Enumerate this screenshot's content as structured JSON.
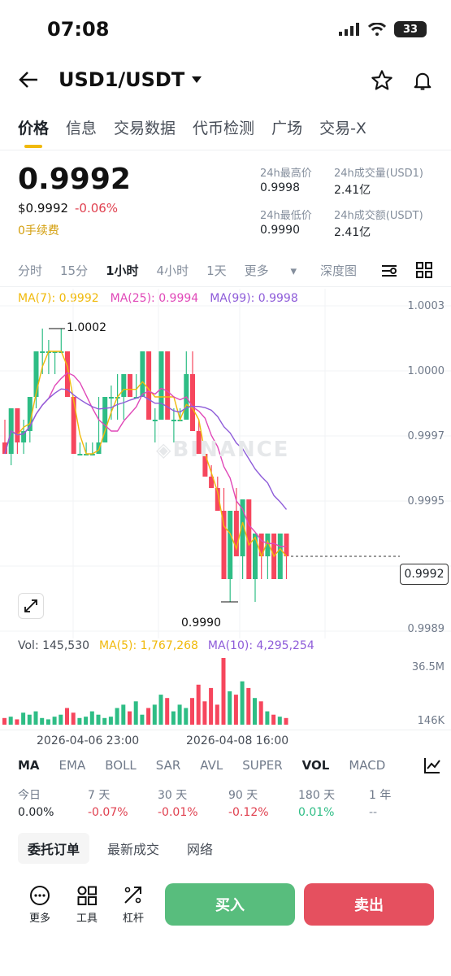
{
  "status_bar": {
    "time": "07:08",
    "battery": "33"
  },
  "header": {
    "pair": "USD1/USDT"
  },
  "tabs": [
    "价格",
    "信息",
    "交易数据",
    "代币检测",
    "广场",
    "交易-X"
  ],
  "ticker": {
    "price": "0.9992",
    "usd_price": "$0.9992",
    "change": "-0.06%",
    "fee": "0手续费",
    "high_label": "24h最高价",
    "high": "0.9998",
    "vol_label": "24h成交量(USD1)",
    "vol": "2.41亿",
    "low_label": "24h最低价",
    "low": "0.9990",
    "turnover_label": "24h成交额(USDT)",
    "turnover": "2.41亿"
  },
  "intervals": [
    "分时",
    "15分",
    "1小时",
    "4小时",
    "1天",
    "更多"
  ],
  "depth_label": "深度图",
  "ma": {
    "ma7": "MA(7): 0.9992",
    "ma25": "MA(25): 0.9994",
    "ma99": "MA(99): 0.9998"
  },
  "price_axis": [
    "1.0003",
    "1.0000",
    "0.9997",
    "0.9995",
    "0.9992",
    "0.9989"
  ],
  "current_price": "0.9992",
  "annotations": {
    "high": "1.0002",
    "low": "0.9990"
  },
  "watermark": "BINANCE",
  "volume": {
    "vol": "Vol: 145,530",
    "ma5": "MA(5): 1,767,268",
    "ma10": "MA(10): 4,295,254",
    "axis_top": "36.5M",
    "axis_bottom": "146K"
  },
  "dates": [
    "2026-04-06 23:00",
    "2026-04-08 16:00"
  ],
  "indicators": [
    "MA",
    "EMA",
    "BOLL",
    "SAR",
    "AVL",
    "SUPER",
    "VOL",
    "MACD"
  ],
  "performance": {
    "labels": [
      "今日",
      "7 天",
      "30 天",
      "90 天",
      "180 天",
      "1 年"
    ],
    "values": [
      "0.00%",
      "-0.07%",
      "-0.01%",
      "-0.12%",
      "0.01%",
      "--"
    ]
  },
  "subtabs": [
    "委托订单",
    "最新成交",
    "网络"
  ],
  "bottom": {
    "more": "更多",
    "tools": "工具",
    "leverage": "杠杆",
    "buy": "买入",
    "sell": "卖出"
  },
  "colors": {
    "up": "#2ebd85",
    "down": "#f6465d",
    "accent": "#f0b90b",
    "ma7": "#f0b90b",
    "ma25": "#e048b8",
    "ma99": "#8e5cd9"
  },
  "chart_data": {
    "type": "candlestick",
    "interval": "1h",
    "ylim": [
      0.9989,
      1.0003
    ],
    "ohlc": [
      [
        0.9997,
        0.9998,
        0.99965,
        0.99965
      ],
      [
        0.99965,
        0.99985,
        0.9996,
        0.99985
      ],
      [
        0.99985,
        0.99985,
        0.99965,
        0.9997
      ],
      [
        0.9997,
        0.9998,
        0.99965,
        0.99975
      ],
      [
        0.99975,
        0.9999,
        0.9997,
        0.9999
      ],
      [
        0.9999,
        1.0001,
        0.99985,
        1.0001
      ],
      [
        1.0001,
        1.0002,
        1.0,
        1.0001
      ],
      [
        1.0001,
        1.00015,
        1.0,
        1.0001
      ],
      [
        1.0001,
        1.0001,
        1.0,
        1.0001
      ],
      [
        1.0001,
        1.0002,
        1.0001,
        1.0001
      ],
      [
        1.0001,
        1.0001,
        0.9999,
        0.9999
      ],
      [
        0.9999,
        0.9999,
        0.99965,
        0.99965
      ],
      [
        0.99965,
        0.9997,
        0.99965,
        0.99965
      ],
      [
        0.99965,
        0.9997,
        0.99965,
        0.99965
      ],
      [
        0.99965,
        0.9997,
        0.99965,
        0.99965
      ],
      [
        0.99965,
        0.9999,
        0.99965,
        0.9997
      ],
      [
        0.9997,
        0.9999,
        0.9997,
        0.9999
      ],
      [
        0.9999,
        0.99995,
        0.9998,
        0.9999
      ],
      [
        0.9999,
        1.0,
        0.9998,
        0.9999
      ],
      [
        0.9999,
        1.0,
        0.9998,
        1.0
      ],
      [
        1.0,
        1.0,
        0.9999,
        0.9999
      ],
      [
        0.9999,
        1.0,
        0.9999,
        0.9999
      ],
      [
        0.9999,
        1.0001,
        0.9999,
        1.0001
      ],
      [
        1.0001,
        1.0001,
        0.9998,
        0.9998
      ],
      [
        0.9998,
        0.99985,
        0.9997,
        0.9998
      ],
      [
        0.9998,
        1.0001,
        0.9998,
        1.0001
      ],
      [
        1.0001,
        1.0001,
        0.9998,
        0.9998
      ],
      [
        0.9998,
        0.99985,
        0.9997,
        0.9998
      ],
      [
        0.9998,
        0.99985,
        0.9998,
        0.9998
      ],
      [
        0.9998,
        1.0001,
        0.9998,
        1.0
      ],
      [
        1.0,
        1.0001,
        0.99975,
        0.99975
      ],
      [
        0.99975,
        0.9998,
        0.99965,
        0.99965
      ],
      [
        0.99965,
        0.9997,
        0.99955,
        0.99955
      ],
      [
        0.99955,
        0.9996,
        0.9995,
        0.9995
      ],
      [
        0.9995,
        0.99955,
        0.9994,
        0.9994
      ],
      [
        0.9994,
        0.9995,
        0.9991,
        0.9991
      ],
      [
        0.9991,
        0.9994,
        0.999,
        0.9994
      ],
      [
        0.9994,
        0.9995,
        0.9992,
        0.9992
      ],
      [
        0.9992,
        0.99945,
        0.9991,
        0.99945
      ],
      [
        0.99945,
        0.99945,
        0.9991,
        0.9991
      ],
      [
        0.9991,
        0.9993,
        0.999,
        0.9993
      ],
      [
        0.9993,
        0.9993,
        0.9991,
        0.9992
      ],
      [
        0.9992,
        0.9993,
        0.9991,
        0.9993
      ],
      [
        0.9993,
        0.9993,
        0.9991,
        0.9991
      ],
      [
        0.9991,
        0.9993,
        0.9991,
        0.9993
      ],
      [
        0.9993,
        0.9993,
        0.9991,
        0.9992
      ]
    ]
  }
}
